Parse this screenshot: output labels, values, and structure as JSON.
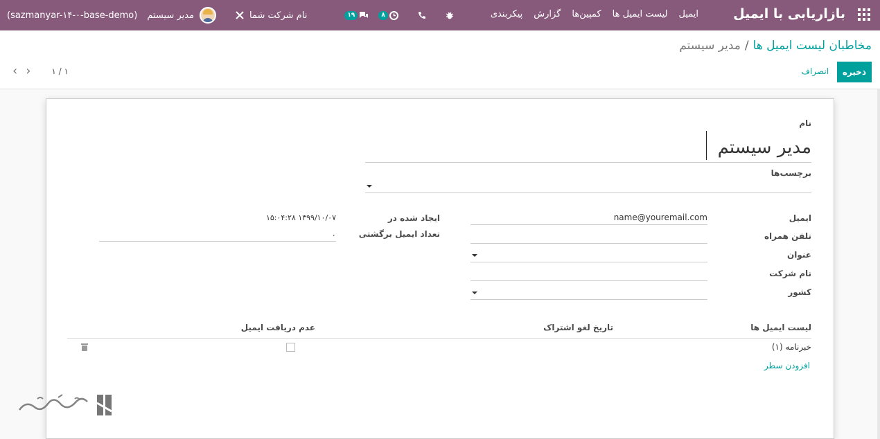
{
  "navbar": {
    "brand": "بازاریابی با ایمیل",
    "menu": [
      "ایمیل",
      "لیست ایمیل ها",
      "کمپین‌ها",
      "گزارش",
      "پیکربندی"
    ],
    "company": "نام شرکت شما",
    "user": "مدیر سیستم",
    "database": "(sazmanyar-۱۴-۰-base-demo)",
    "messages_count": "۱۹",
    "activities_count": "۸",
    "colors": {
      "primary": "#875a7b",
      "accent": "#00a09d"
    }
  },
  "control_panel": {
    "breadcrumb_parent": "مخاطبان لیست ایمیل ها",
    "breadcrumb_sep": "/",
    "breadcrumb_current": "مدیر سیستم",
    "save_label": "ذخیره",
    "discard_label": "انصراف",
    "pager": "۱ / ۱"
  },
  "form": {
    "name_label": "نام",
    "name_value": "مدیر سیستم",
    "tags_label": "برچسب‌ها",
    "email_label": "ایمیل",
    "email_value": "name@youremail.com",
    "mobile_label": "تلفن همراه",
    "mobile_value": "",
    "title_label": "عنوان",
    "company_label": "نام شرکت",
    "company_value": "",
    "country_label": "کشور",
    "created_label": "ایجاد شده در",
    "created_value": "۱۳۹۹/۱۰/۰۷ ۱۵:۰۴:۲۸",
    "bounce_label": "تعداد ایمیل برگشتی",
    "bounce_value": "۰"
  },
  "subscriptions": {
    "columns": [
      "لیست ایمیل ها",
      "تاریخ لغو اشتراک",
      "عدم دریافت ایمیل"
    ],
    "rows": [
      {
        "list": "خبرنامه (۱)",
        "unsubscribed_date": "",
        "opt_out": false
      }
    ],
    "add_line_label": "افزودن سطر"
  }
}
